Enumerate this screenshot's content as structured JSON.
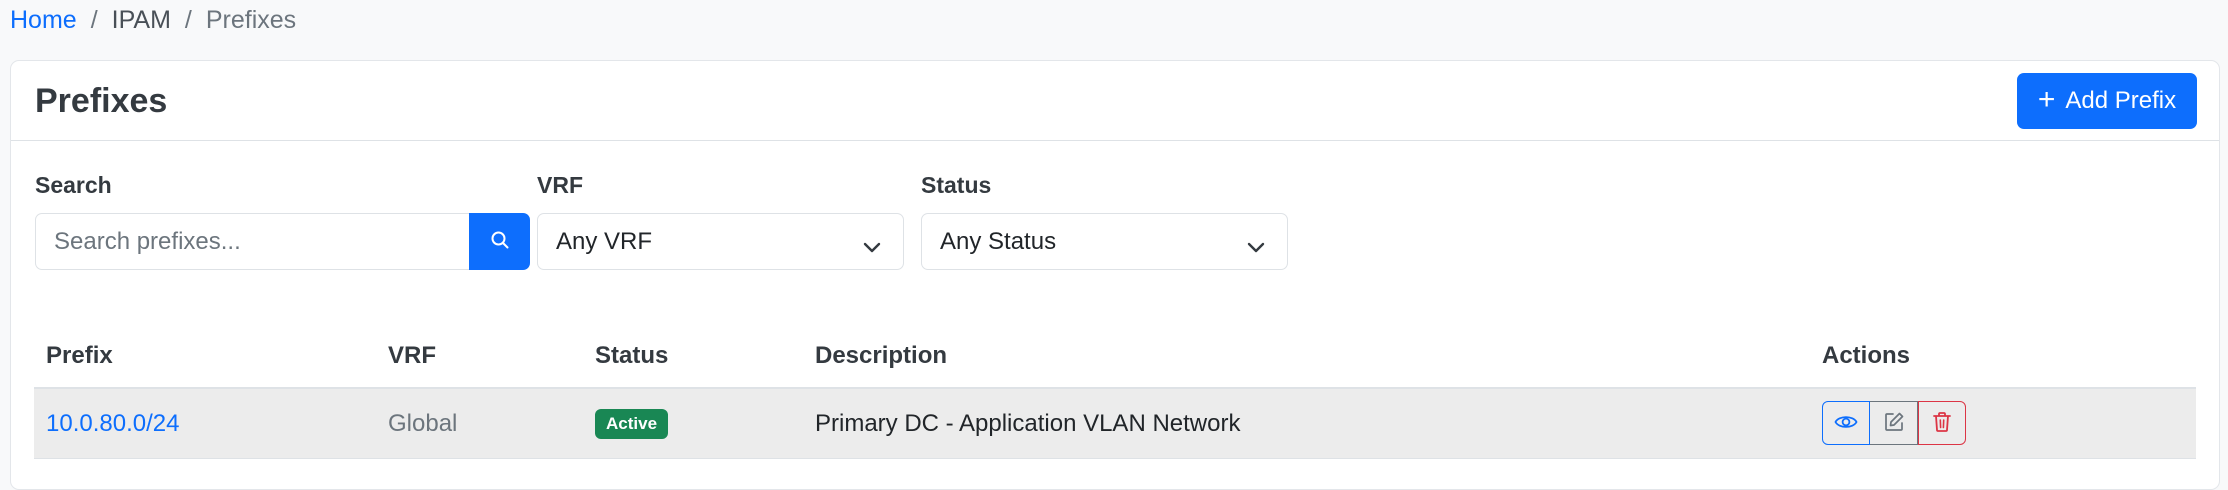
{
  "breadcrumb": {
    "home": "Home",
    "section": "IPAM",
    "current": "Prefixes",
    "separator": "/"
  },
  "header": {
    "title": "Prefixes",
    "add_button_label": "Add Prefix",
    "add_button_icon": "plus-icon"
  },
  "filters": {
    "search": {
      "label": "Search",
      "placeholder": "Search prefixes...",
      "value": "",
      "button_icon": "search-icon"
    },
    "vrf": {
      "label": "VRF",
      "selected": "Any VRF"
    },
    "status": {
      "label": "Status",
      "selected": "Any Status"
    }
  },
  "table": {
    "columns": [
      "Prefix",
      "VRF",
      "Status",
      "Description",
      "Actions"
    ],
    "rows": [
      {
        "prefix": "10.0.80.0/24",
        "vrf": "Global",
        "status": "Active",
        "description": "Primary DC - Application VLAN Network",
        "actions": [
          "eye-icon",
          "edit-icon",
          "trash-icon"
        ]
      }
    ]
  },
  "colors": {
    "primary": "#0d6efd",
    "success": "#198754",
    "danger": "#dc3545",
    "secondary": "#6c757d"
  }
}
